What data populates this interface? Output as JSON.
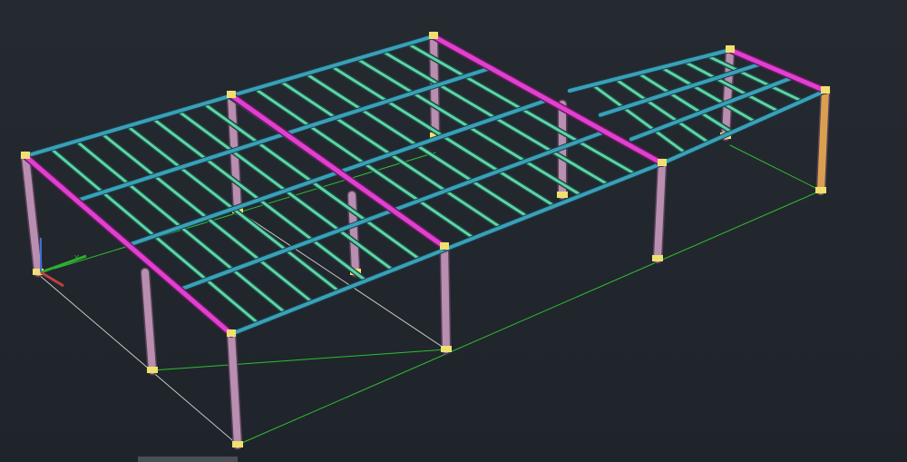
{
  "viewport": {
    "background": "#23282f",
    "ucs_axis_label": "Y"
  },
  "model": {
    "colors": {
      "eave_beam": "#3aa0b8",
      "purlin": "#5fd3a8",
      "rafter": "#e040d0",
      "column": "#b88fb0",
      "column_alt": "#d9a050",
      "base_plate": "#f0e070",
      "grid_line_green": "#2fbf2f",
      "grid_line_white": "#c8c8c8"
    }
  }
}
